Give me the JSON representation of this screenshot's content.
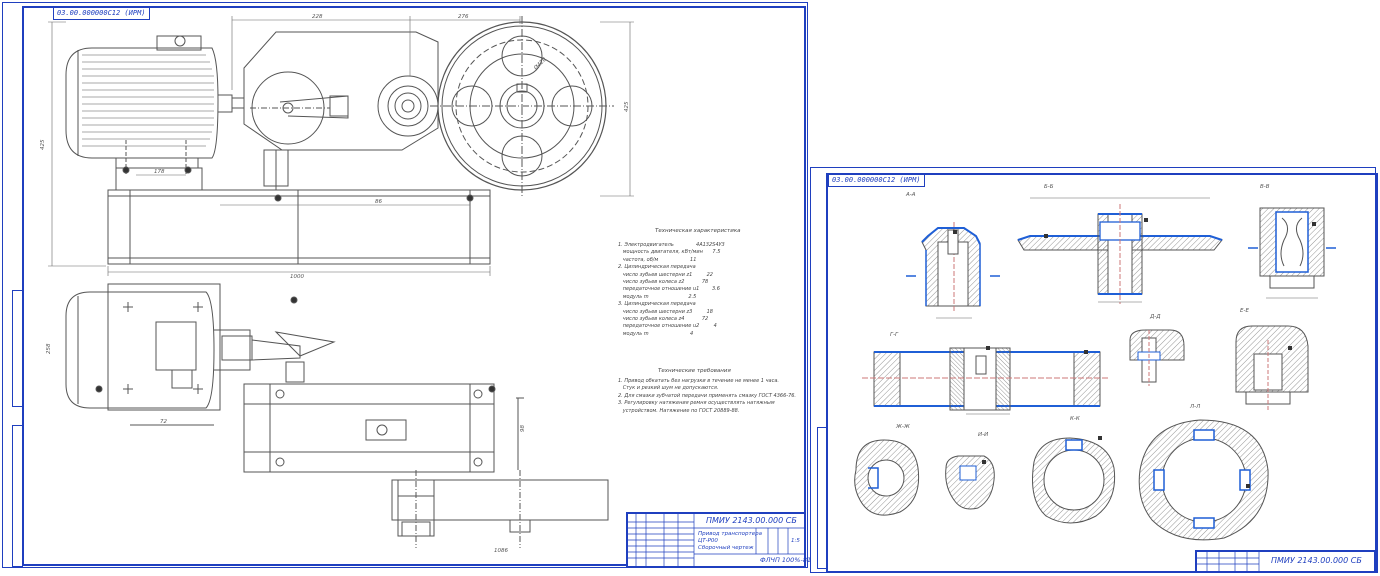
{
  "sheet1": {
    "code": "03.00.000000С12 (ИРМ)",
    "title_block": {
      "designation": "ПМИУ 2143.00.000 СБ",
      "name_line1": "Привод транспортера",
      "name_line2": "ЦТ-Р00",
      "name_line3": "Сборочный чертеж",
      "org": "ФЛЧП 100%-81",
      "scale": "1:5"
    },
    "tech_title": "Техническая характеристика",
    "tech_lines": [
      "1. Электродвигатель              4А132S4У3",
      "   мощность двигателя, кВт/мин      7.5",
      "   частота, об/м                    11",
      "2. Цилиндрическая передача",
      "   число зубьев шестерни z1         22",
      "   число зубьев колеса z2           78",
      "   передаточное отношение u1        3.6",
      "   модуль m                         2.5",
      "3. Цилиндрическая передача",
      "   число зубьев шестерни z3         18",
      "   число зубьев колеса z4           72",
      "   передаточное отношение u2         4",
      "   модуль m                          4"
    ],
    "req_title": "Технические требования",
    "req_lines": [
      "1. Привод обкатать без нагрузки в течение не менее 1 часа.",
      "   Стук и резкий шум не допускаются.",
      "2. Для смазки зубчатой передачи применять смазку ГОСТ 4366-76.",
      "3. Регулировку натяжения ремня осуществлять натяжным",
      "   устройством. Натяжение по ГОСТ 20889-88."
    ],
    "dims": [
      "228",
      "276",
      "425",
      "1000",
      "86",
      "178",
      "258",
      "72",
      "98",
      "1086",
      "Ø420"
    ]
  },
  "sheet2": {
    "code": "03.00.000000С12 (ИРМ)",
    "title_block": {
      "designation": "ПМИУ 2143.00.000 СБ"
    },
    "section_labels": [
      "А-А",
      "Б-Б",
      "В-В",
      "Г-Г",
      "Д-Д",
      "Е-Е",
      "Ж-Ж",
      "И-И",
      "К-К",
      "Л-Л"
    ]
  },
  "colors": {
    "frame": "#1f3fbf",
    "line": "#555555",
    "section_line": "#1f5fd6",
    "hatch": "#777777",
    "text": "#444444"
  }
}
